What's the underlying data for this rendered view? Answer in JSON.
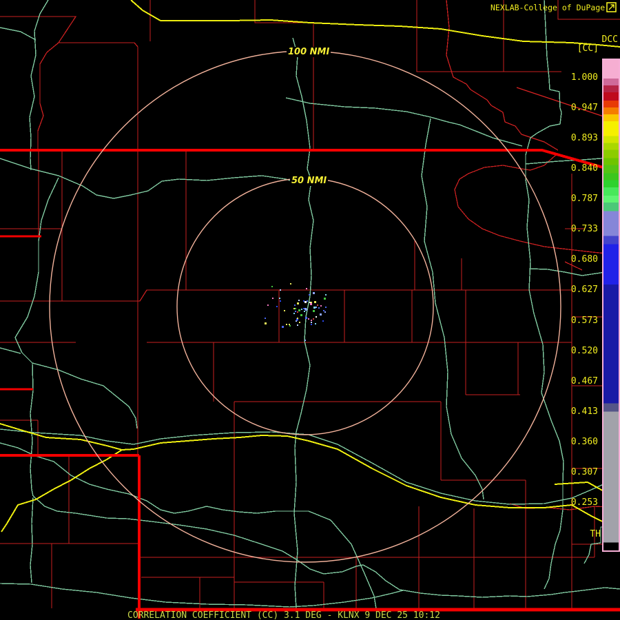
{
  "header": {
    "title": "NEXLAB-College of DuPage",
    "icon": "corner-arrow-icon",
    "product_code": "DCC",
    "product_unit": "[CC]"
  },
  "colorbar": {
    "labels": [
      "1.000",
      "0.947",
      "0.893",
      "0.840",
      "0.787",
      "0.733",
      "0.680",
      "0.627",
      "0.573",
      "0.520",
      "0.467",
      "0.413",
      "0.360",
      "0.307",
      "0.253"
    ],
    "threshold_label": "TH",
    "border_color": "#f8b0d8",
    "label_color": "#f2ee20",
    "segments": [
      {
        "color": "#f6aed2",
        "to": 0.038
      },
      {
        "color": "#cf6a9a",
        "to": 0.052
      },
      {
        "color": "#b52446",
        "to": 0.066
      },
      {
        "color": "#bf0a1e",
        "to": 0.083
      },
      {
        "color": "#e83a06",
        "to": 0.097
      },
      {
        "color": "#f57d00",
        "to": 0.111
      },
      {
        "color": "#fac800",
        "to": 0.125
      },
      {
        "color": "#f6f000",
        "to": 0.155
      },
      {
        "color": "#d2e600",
        "to": 0.169
      },
      {
        "color": "#aad800",
        "to": 0.183
      },
      {
        "color": "#8ccc00",
        "to": 0.2
      },
      {
        "color": "#6ec400",
        "to": 0.214
      },
      {
        "color": "#55c414",
        "to": 0.231
      },
      {
        "color": "#3cc61e",
        "to": 0.245
      },
      {
        "color": "#2ed22e",
        "to": 0.26
      },
      {
        "color": "#47e85a",
        "to": 0.277
      },
      {
        "color": "#5ff473",
        "to": 0.291
      },
      {
        "color": "#4cc878",
        "to": 0.308
      },
      {
        "color": "#8686d8",
        "to": 0.359
      },
      {
        "color": "#4444cc",
        "to": 0.376
      },
      {
        "color": "#2222e8",
        "to": 0.458
      },
      {
        "color": "#1a1aa6",
        "to": 0.7
      },
      {
        "color": "#555588",
        "to": 0.717
      },
      {
        "color": "#a2a2aa",
        "to": 0.984
      },
      {
        "color": "#000000",
        "to": 1.0
      }
    ]
  },
  "map": {
    "range_rings": [
      {
        "label": "100 NMI",
        "radius_nmi": 100
      },
      {
        "label": "50 NMI",
        "radius_nmi": 50
      }
    ],
    "colors": {
      "county": "#c92020",
      "highway": "#f30000",
      "river": "#7fc89f",
      "road": "#efef10",
      "ring": "#f2b29b",
      "radar_dot_palette": [
        "#2b49f0",
        "#2b49f0",
        "#4a66f2",
        "#4a66f2",
        "#8fa6ff",
        "#bcd2ff",
        "#ffffff",
        "#7fd4ef",
        "#43c43f",
        "#cc3b3b",
        "#f078c0",
        "#e8e85a"
      ]
    }
  },
  "status_bar": {
    "text": "CORRELATION COEFFICIENT (CC) 3.1 DEG - KLNX 9 DEC 25 10:12",
    "color": "#ccd94a"
  }
}
